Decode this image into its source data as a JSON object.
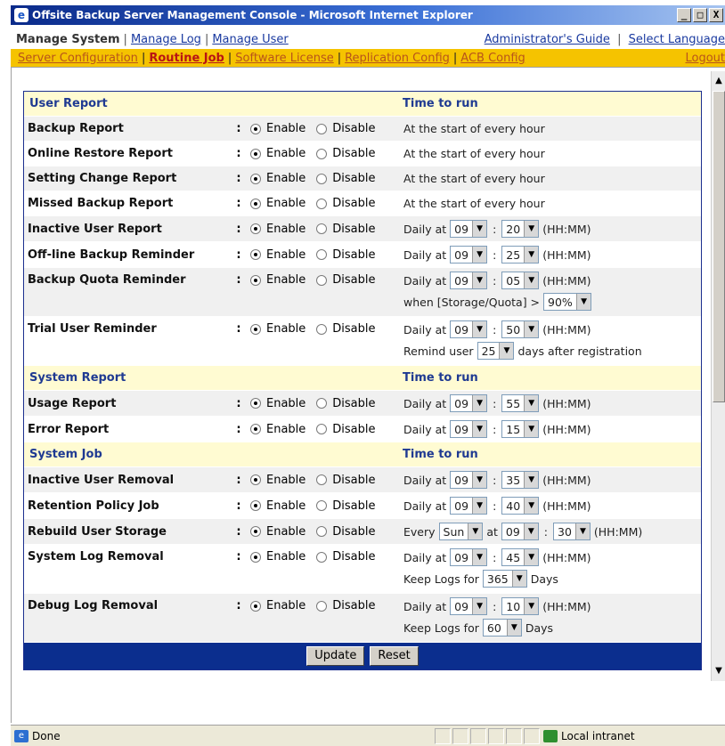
{
  "window": {
    "title": "Offsite Backup Server Management Console - Microsoft Internet Explorer",
    "min": "_",
    "max": "□",
    "close": "X"
  },
  "nav1": {
    "current": "Manage System",
    "links": [
      "Manage Log",
      "Manage User"
    ],
    "right_links": [
      "Administrator's Guide",
      "Select Language"
    ]
  },
  "nav2": {
    "items": [
      "Server Configuration",
      "Routine Job",
      "Software License",
      "Replication Config",
      "ACB Config"
    ],
    "active": "Routine Job",
    "logout": "Logout"
  },
  "common": {
    "colon": ":",
    "enable": "Enable",
    "disable": "Disable",
    "hhmm": "(HH:MM)",
    "daily_at": "Daily at",
    "time_colon": ":"
  },
  "sections": {
    "user_report": {
      "title": "User Report",
      "time_header": "Time to run"
    },
    "system_report": {
      "title": "System Report",
      "time_header": "Time to run"
    },
    "system_job": {
      "title": "System Job",
      "time_header": "Time to run"
    }
  },
  "rows": {
    "backup_report": {
      "label": "Backup Report",
      "time": "At the start of every hour"
    },
    "online_restore_report": {
      "label": "Online Restore Report",
      "time": "At the start of every hour"
    },
    "setting_change_report": {
      "label": "Setting Change Report",
      "time": "At the start of every hour"
    },
    "missed_backup_report": {
      "label": "Missed Backup Report",
      "time": "At the start of every hour"
    },
    "inactive_user_report": {
      "label": "Inactive User Report",
      "hh": "09",
      "mm": "20"
    },
    "offline_backup_reminder": {
      "label": "Off-line Backup Reminder",
      "hh": "09",
      "mm": "25"
    },
    "backup_quota_reminder": {
      "label": "Backup Quota Reminder",
      "hh": "09",
      "mm": "05",
      "extra_prefix": "when [Storage/Quota] >",
      "extra_value": "90%"
    },
    "trial_user_reminder": {
      "label": "Trial User Reminder",
      "hh": "09",
      "mm": "50",
      "extra_prefix": "Remind user",
      "extra_value": "25",
      "extra_suffix": "days after registration"
    },
    "usage_report": {
      "label": "Usage Report",
      "hh": "09",
      "mm": "55"
    },
    "error_report": {
      "label": "Error Report",
      "hh": "09",
      "mm": "15"
    },
    "inactive_user_removal": {
      "label": "Inactive User Removal",
      "hh": "09",
      "mm": "35"
    },
    "retention_policy_job": {
      "label": "Retention Policy Job",
      "hh": "09",
      "mm": "40"
    },
    "rebuild_user_storage": {
      "label": "Rebuild User Storage",
      "every": "Every",
      "day": "Sun",
      "at": "at",
      "hh": "09",
      "mm": "30"
    },
    "system_log_removal": {
      "label": "System Log Removal",
      "hh": "09",
      "mm": "45",
      "keep_prefix": "Keep Logs for",
      "keep_value": "365",
      "keep_suffix": "Days"
    },
    "debug_log_removal": {
      "label": "Debug Log Removal",
      "hh": "09",
      "mm": "10",
      "keep_prefix": "Keep Logs for",
      "keep_value": "60",
      "keep_suffix": "Days"
    }
  },
  "buttons": {
    "update": "Update",
    "reset": "Reset"
  },
  "status": {
    "text": "Done",
    "zone": "Local intranet"
  },
  "colors": {
    "accent_blue": "#0b2e8e",
    "nav_yellow": "#f5c300",
    "header_bg": "#fffbd2",
    "active_link": "#b81414"
  }
}
